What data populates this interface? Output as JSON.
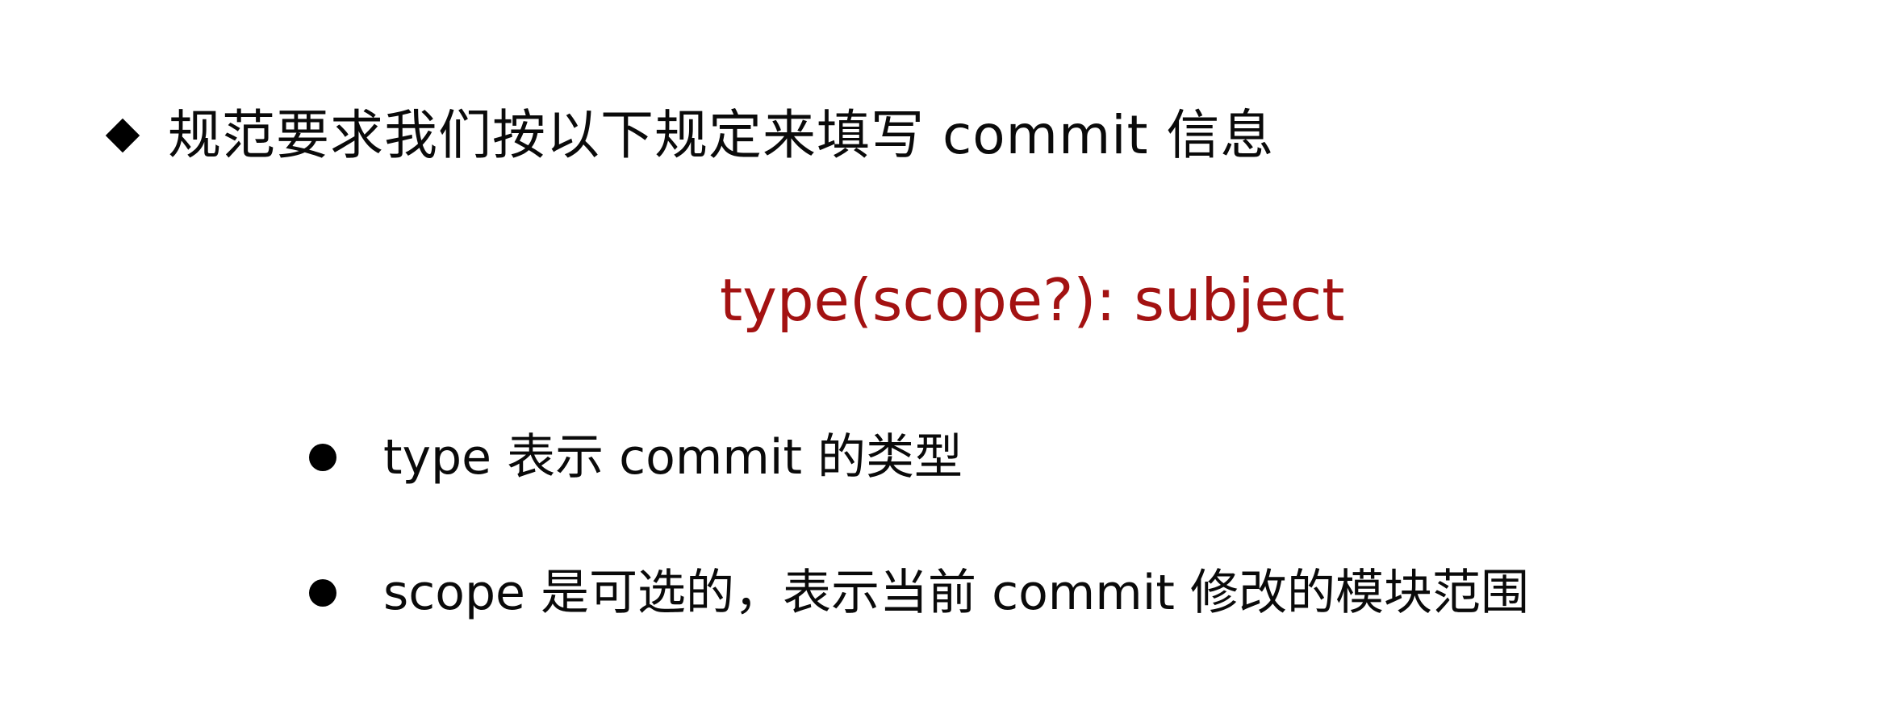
{
  "heading": {
    "text": "规范要求我们按以下规定来填写 commit 信息",
    "marker_icon": "diamond-bullet-icon"
  },
  "formula": {
    "text": "type(scope?): subject",
    "color": "#a31212"
  },
  "bullets": [
    {
      "text": "type 表示 commit 的类型"
    },
    {
      "text": "scope 是可选的，表示当前 commit 修改的模块范围"
    }
  ]
}
